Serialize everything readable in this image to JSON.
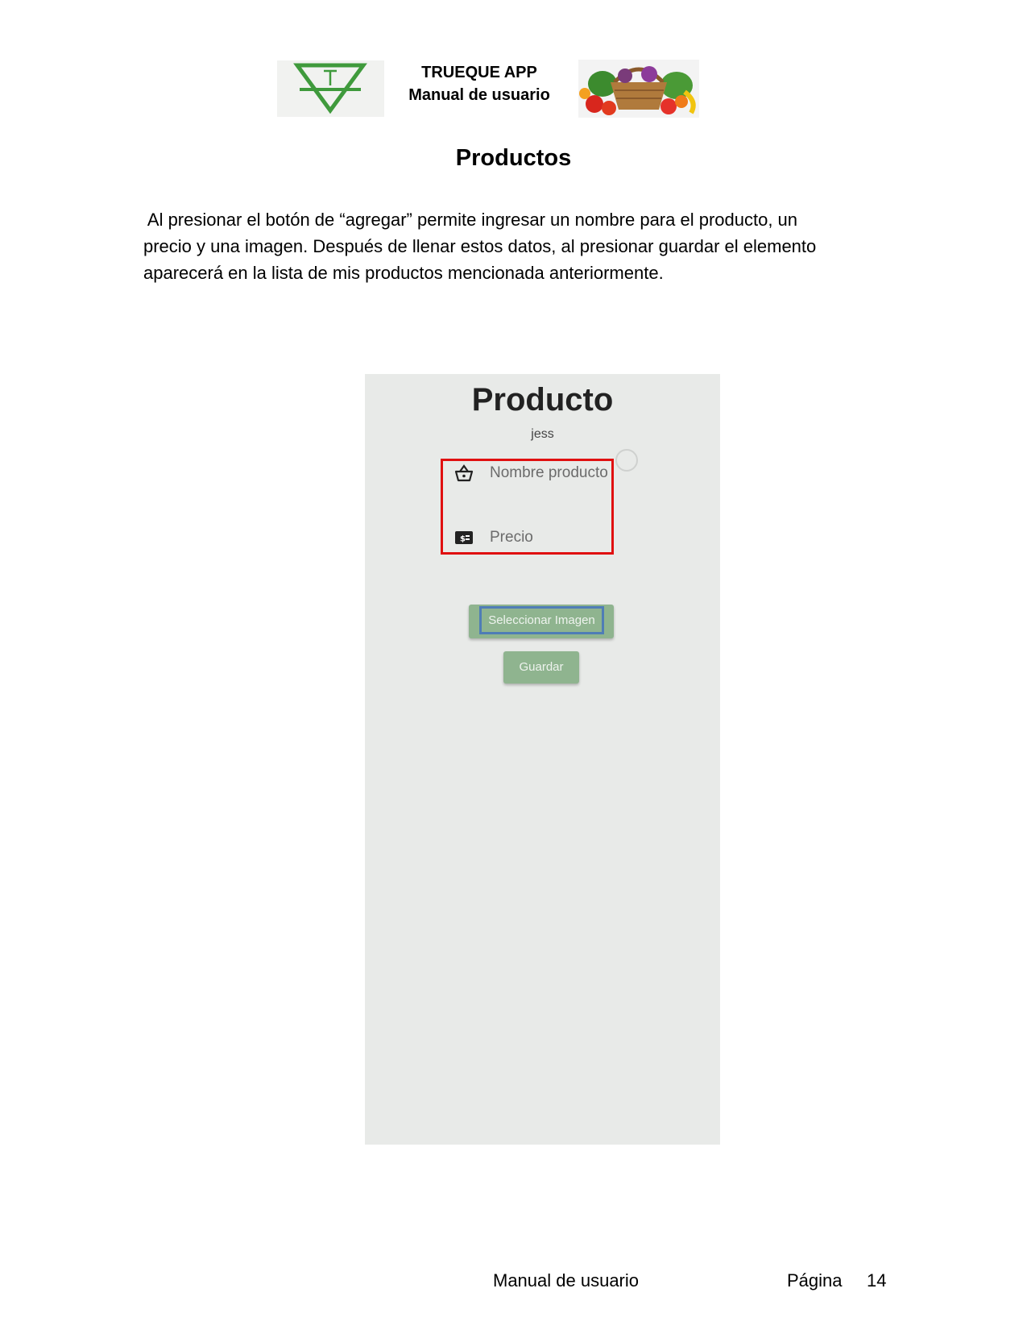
{
  "header": {
    "app_name": "TRUEQUE APP",
    "subtitle": "Manual de usuario",
    "logo_icon": "trueque-triangle-logo",
    "logo_color": "#3f9a3c",
    "basket_icon": "fruit-basket-image"
  },
  "section": {
    "title": "Productos",
    "paragraph_lines": [
      " Al presionar el botón de “agregar” permite ingresar un nombre para el producto, un",
      "precio y una imagen. Después de llenar estos datos, al presionar guardar el elemento",
      "aparecerá en la lista de mis productos mencionada anteriormente."
    ]
  },
  "screenshot": {
    "title": "Producto",
    "user": "jess",
    "name_field_placeholder": "Nombre producto",
    "price_field_placeholder": "Precio",
    "select_image_button": "Seleccionar Imagen",
    "save_button": "Guardar",
    "highlight_colors": {
      "fields": "#e01010",
      "select_button": "#4f7db6"
    },
    "button_color": "#8fb48f"
  },
  "footer": {
    "manual_label": "Manual de usuario",
    "page_label": "Página",
    "page_number": "14"
  }
}
